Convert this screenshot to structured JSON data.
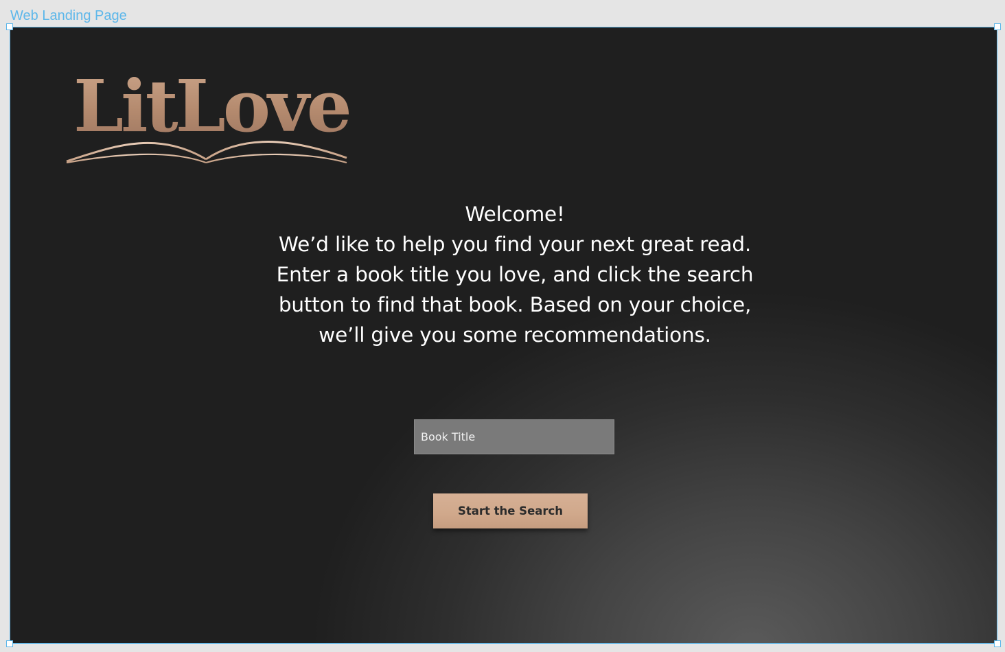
{
  "frame": {
    "label": "Web Landing Page"
  },
  "logo": {
    "text": "LitLove",
    "icon": "open-book-icon"
  },
  "intro": {
    "lines": [
      "Welcome!",
      "We’d like to help you find your next great read.",
      "Enter a book title you love, and click the search",
      "button to find that book. Based on your choice,",
      "we’ll give you some recommendations."
    ]
  },
  "search": {
    "placeholder": "Book Title",
    "value": "",
    "button_label": "Start the Search"
  },
  "colors": {
    "background": "#1f1f1f",
    "accent": "#d0a88b",
    "logo_gold": "#b48a6e",
    "input_bg": "#7a7a7a",
    "frame_outline": "#5db7ea"
  }
}
